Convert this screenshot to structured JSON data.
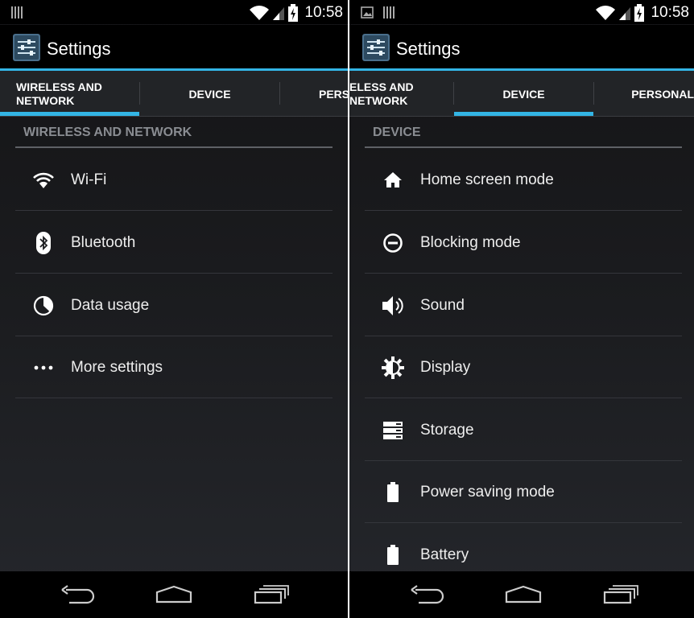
{
  "status_bar": {
    "time": "10:58"
  },
  "app": {
    "title": "Settings"
  },
  "left": {
    "tabs": [
      {
        "label": "WIRELESS AND NETWORK"
      },
      {
        "label": "DEVICE"
      },
      {
        "label": "PERS"
      }
    ],
    "section_header": "WIRELESS AND NETWORK",
    "items": [
      {
        "label": "Wi-Fi",
        "icon": "wifi-icon"
      },
      {
        "label": "Bluetooth",
        "icon": "bluetooth-icon"
      },
      {
        "label": "Data usage",
        "icon": "data-usage-icon"
      },
      {
        "label": "More settings",
        "icon": "more-icon"
      }
    ]
  },
  "right": {
    "tabs": [
      {
        "label": "ELESS AND NETWORK"
      },
      {
        "label": "DEVICE"
      },
      {
        "label": "PERSONAL"
      }
    ],
    "section_header": "DEVICE",
    "items": [
      {
        "label": "Home screen mode",
        "icon": "home-icon"
      },
      {
        "label": "Blocking mode",
        "icon": "blocking-icon"
      },
      {
        "label": "Sound",
        "icon": "speaker-icon"
      },
      {
        "label": "Display",
        "icon": "brightness-icon"
      },
      {
        "label": "Storage",
        "icon": "storage-icon"
      },
      {
        "label": "Power saving mode",
        "icon": "battery-icon"
      },
      {
        "label": "Battery",
        "icon": "battery-icon"
      }
    ]
  },
  "colors": {
    "accent": "#33b5e5",
    "background": "#1b1c1f",
    "header_text": "#8a8d92"
  }
}
